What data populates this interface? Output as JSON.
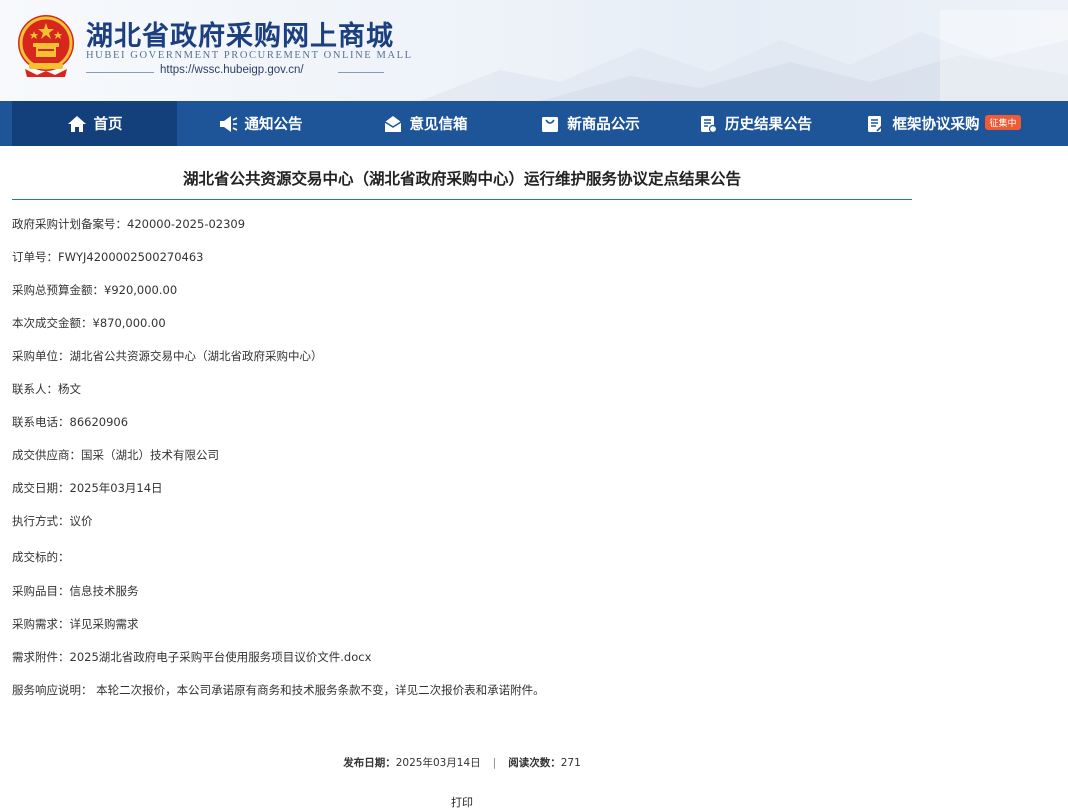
{
  "header": {
    "title": "湖北省政府采购网上商城",
    "subtitle_en": "HUBEI GOVERNMENT PROCUREMENT ONLINE MALL",
    "url": "https://wssc.hubeigp.gov.cn/",
    "emblem_icon": "national-emblem-icon",
    "brand_color": "#1c3f80"
  },
  "nav": {
    "bg_color": "#1e5599",
    "active_color": "#13407a",
    "items": [
      {
        "label": "首页",
        "icon": "home-icon"
      },
      {
        "label": "通知公告",
        "icon": "megaphone-icon"
      },
      {
        "label": "意见信箱",
        "icon": "mailbox-icon"
      },
      {
        "label": "新商品公示",
        "icon": "bag-icon"
      },
      {
        "label": "历史结果公告",
        "icon": "document-icon"
      },
      {
        "label": "框架协议采购",
        "icon": "contract-icon",
        "badge": "征集中"
      }
    ]
  },
  "article": {
    "title": "湖北省公共资源交易中心（湖北省政府采购中心）运行维护服务协议定点结果公告",
    "fields": [
      {
        "label": "政府采购计划备案号：",
        "value": "420000-2025-02309"
      },
      {
        "label": "订单号：",
        "value": "FWYJ4200002500270463"
      },
      {
        "label": "采购总预算金额：",
        "value": "¥920,000.00"
      },
      {
        "label": "本次成交金额：",
        "value": "¥870,000.00"
      },
      {
        "label": "采购单位：",
        "value": "湖北省公共资源交易中心（湖北省政府采购中心）"
      },
      {
        "label": "联系人：",
        "value": "杨文"
      },
      {
        "label": "联系电话：",
        "value": "86620906"
      },
      {
        "label": "成交供应商：",
        "value": "国采（湖北）技术有限公司"
      },
      {
        "label": "成交日期：",
        "value": "2025年03月14日"
      },
      {
        "label": "执行方式：",
        "value": "议价"
      },
      {
        "label": "成交标的：",
        "value": ""
      },
      {
        "label": "采购品目：",
        "value": "信息技术服务"
      },
      {
        "label": "采购需求：",
        "value": "详见采购需求"
      },
      {
        "label": "需求附件：",
        "value": "2025湖北省政府电子采购平台使用服务项目议价文件.docx"
      },
      {
        "label": "服务响应说明：",
        "value": " 本轮二次报价，本公司承诺原有商务和技术服务条款不变，详见二次报价表和承诺附件。"
      }
    ]
  },
  "meta": {
    "publish_label": "发布日期：",
    "publish_date": "2025年03月14日",
    "separator": "|",
    "views_label": "阅读次数：",
    "views": "271"
  },
  "print_label": "打印"
}
